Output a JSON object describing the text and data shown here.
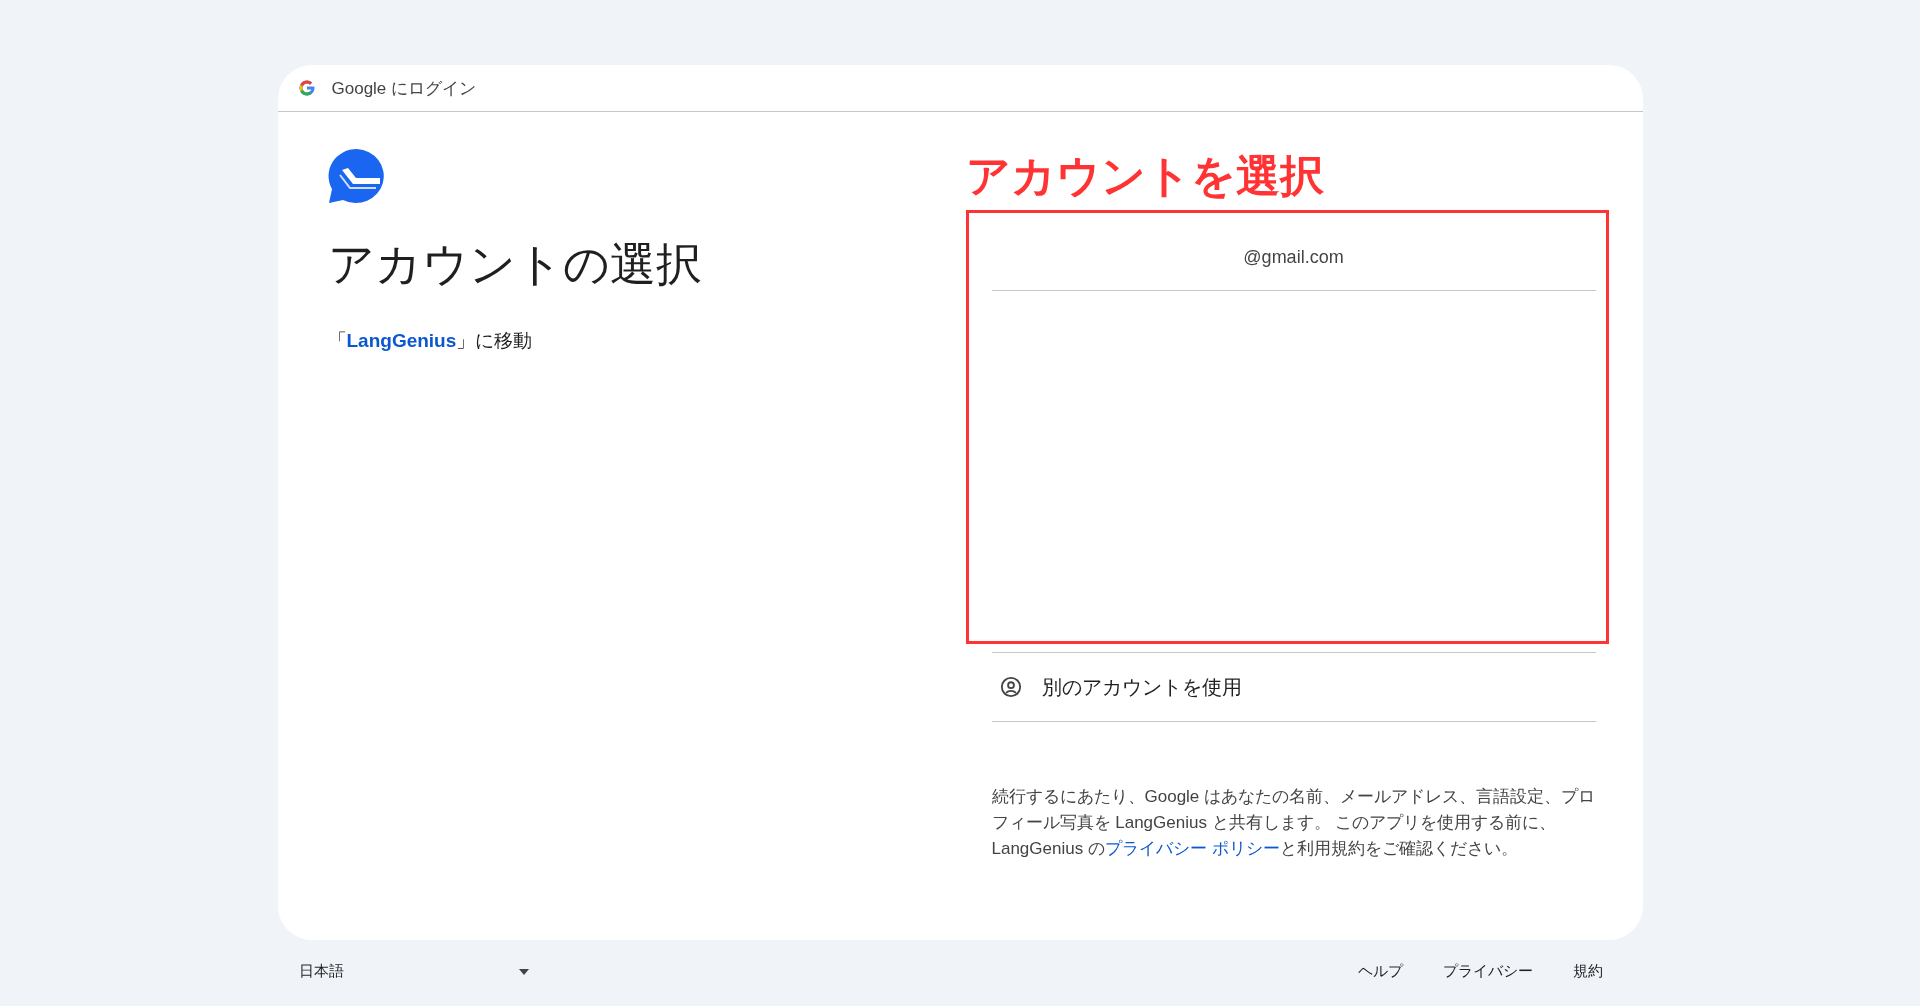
{
  "header": {
    "title": "Google にログイン"
  },
  "left": {
    "heading": "アカウントの選択",
    "subtitle_before": "「",
    "app_name": "LangGenius",
    "subtitle_after": "」に移動"
  },
  "annotation": {
    "label": "アカウントを選択",
    "color": "#ff3333"
  },
  "accounts": [
    {
      "email": "@gmail.com"
    }
  ],
  "other_account": {
    "label": "別のアカウントを使用"
  },
  "consent": {
    "before": "続行するにあたり、Google はあなたの名前、メールアドレス、言語設定、プロフィール写真を LangGenius と共有します。 このアプリを使用する前に、LangGenius の",
    "link": "プライバシー ポリシー",
    "after": "と利用規約をご確認ください。"
  },
  "footer": {
    "language": "日本語",
    "links": [
      "ヘルプ",
      "プライバシー",
      "規約"
    ]
  }
}
